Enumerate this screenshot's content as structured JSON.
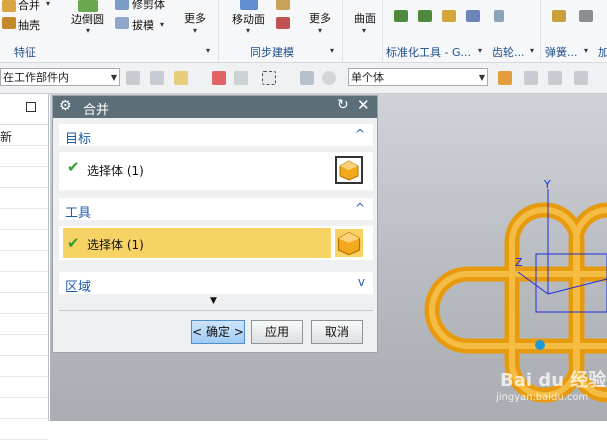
{
  "ribbon": {
    "feature": {
      "merge": "合并",
      "shell": "抽壳",
      "group_label": "特征"
    },
    "edge": {
      "blend": "边倒圆",
      "trim_body": "修剪体",
      "draft": "拔模"
    },
    "more1": "更多",
    "sync": {
      "move_face": "移动面",
      "more": "更多",
      "group_label": "同步建模"
    },
    "curve": "曲面",
    "std_parts_label": "标准化工具 - G...",
    "gear_label": "齿轮...",
    "spring_label": "弹簧...",
    "extra_label": "加"
  },
  "toolbar": {
    "scope_value": "在工作部件内",
    "body_filter_value": "单个体"
  },
  "left_panel": {
    "header_text": "新"
  },
  "dialog": {
    "title": "合并",
    "target": {
      "title": "目标",
      "select_label": "选择体 (1)"
    },
    "tool": {
      "title": "工具",
      "select_label": "选择体 (1)"
    },
    "region": {
      "title": "区域"
    },
    "buttons": {
      "ok": "< 确定 >",
      "apply": "应用",
      "cancel": "取消"
    }
  },
  "viewport": {
    "axis_y": "Y",
    "axis_z": "Z",
    "watermark": "Bai du 经验",
    "watermark_url": "jingyan.baidu.com"
  },
  "colors": {
    "accent": "#1f5fa8",
    "title_bar": "#5c6f78",
    "highlight_row": "#f7d264",
    "part_orange": "#f2a91b",
    "check_green": "#2f9e2b"
  }
}
